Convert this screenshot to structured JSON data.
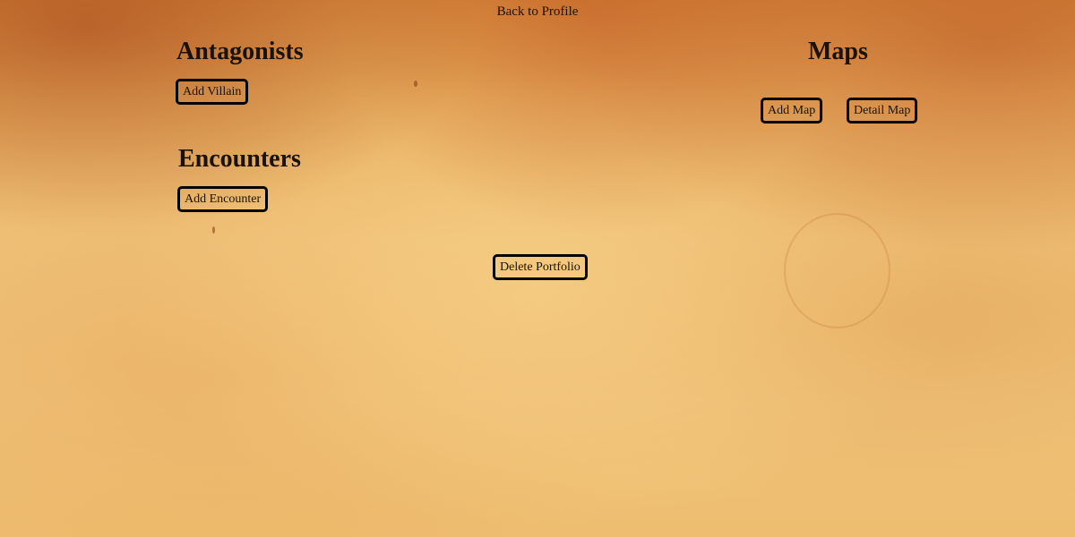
{
  "nav": {
    "back_label": "Back to Profile"
  },
  "antagonists": {
    "heading": "Antagonists",
    "add_label": "Add Villain"
  },
  "encounters": {
    "heading": "Encounters",
    "add_label": "Add Encounter"
  },
  "maps": {
    "heading": "Maps",
    "add_label": "Add Map",
    "detail_label": "Detail Map"
  },
  "portfolio": {
    "delete_label": "Delete Portfolio"
  }
}
